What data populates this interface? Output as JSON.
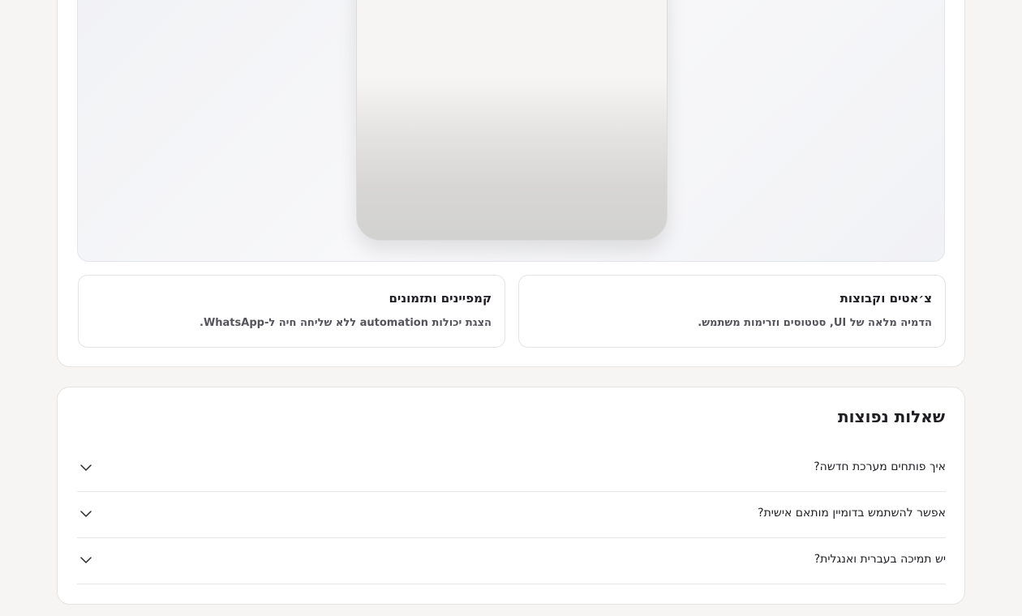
{
  "features": [
    {
      "title": "צ׳אטים וקבוצות",
      "description": "הדמיה מלאה של UI, סטטוסים וזרימות משתמש."
    },
    {
      "title": "קמפיינים ותזמונים",
      "description": "הצגת יכולות automation ללא שליחה חיה ל-WhatsApp."
    }
  ],
  "faq": {
    "title": "שאלות נפוצות",
    "items": [
      {
        "question": "איך פותחים מערכת חדשה?"
      },
      {
        "question": "אפשר להשתמש בדומיין מותאם אישית?"
      },
      {
        "question": "יש תמיכה בעברית ואנגלית?"
      }
    ]
  }
}
